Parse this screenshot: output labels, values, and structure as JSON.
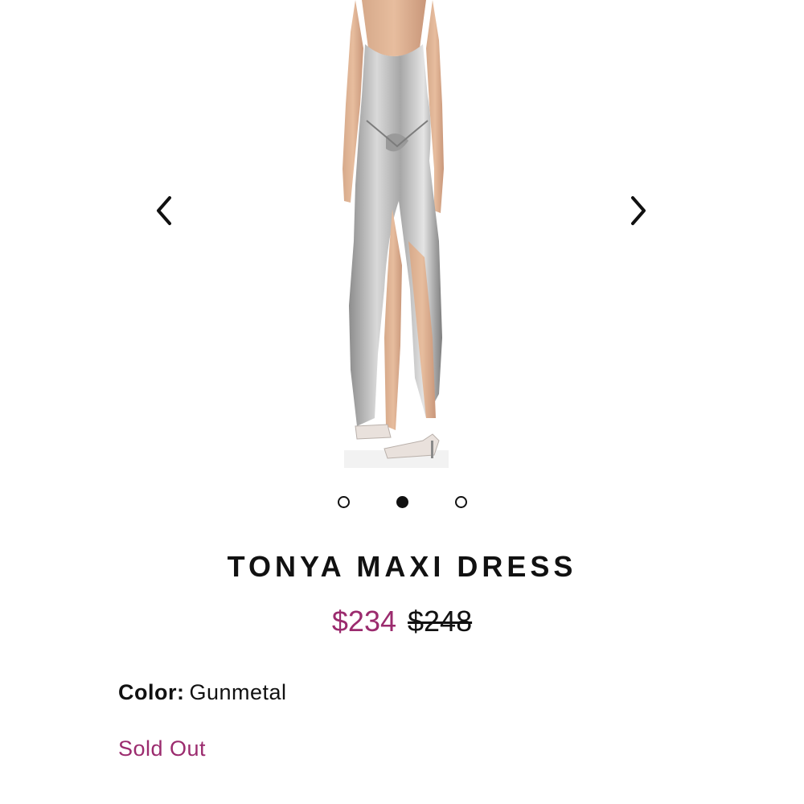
{
  "gallery": {
    "image": "tonya-maxi-dress-silver-photo",
    "prev_icon": "chevron-left-icon",
    "next_icon": "chevron-right-icon",
    "dots": [
      {
        "active": false
      },
      {
        "active": true
      },
      {
        "active": false
      }
    ]
  },
  "product": {
    "title": "TONYA MAXI DRESS",
    "price_sale": "$234",
    "price_original": "$248",
    "color_label": "Color:",
    "color_value": "Gunmetal",
    "status": "Sold Out"
  },
  "colors": {
    "accent": "#9b2b6e",
    "text": "#111111",
    "background": "#ffffff"
  }
}
